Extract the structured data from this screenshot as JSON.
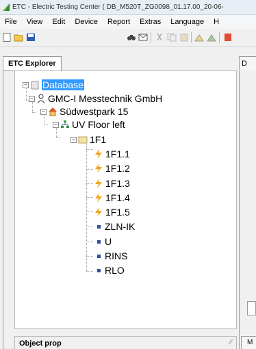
{
  "window": {
    "title": "ETC - Electric Testing Center ( DB_M520T_ZG0098_01.17.00_20-06-"
  },
  "menu": [
    "File",
    "View",
    "Edit",
    "Device",
    "Report",
    "Extras",
    "Language",
    "H"
  ],
  "tabs": {
    "explorer": "ETC Explorer",
    "right": "D"
  },
  "tree": {
    "root": "Database",
    "company": "GMC-I Messtechnik GmbH",
    "site": "Südwestpark 15",
    "distributor": "UV Floor left",
    "circuit": "1F1",
    "circuits": [
      "1F1.1",
      "1F1.2",
      "1F1.3",
      "1F1.4",
      "1F1.5"
    ],
    "measurements": [
      "ZLN-IK",
      "U",
      "RINS",
      "RLO"
    ]
  },
  "bottom": {
    "label": "Object prop",
    "right_label": "M"
  },
  "colors": {
    "selection": "#3399ff",
    "titlebar": "#e8eef5"
  }
}
